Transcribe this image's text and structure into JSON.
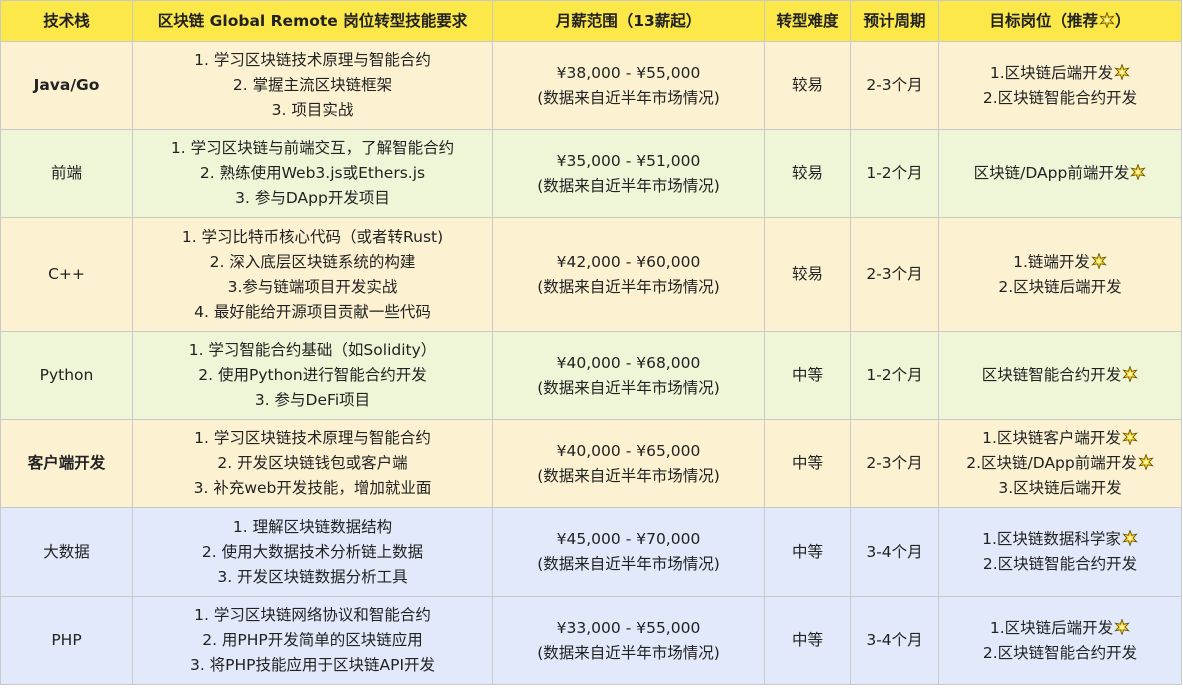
{
  "headers": [
    "技术栈",
    "区块链 Global Remote 岗位转型技能要求",
    "月薪范围（13薪起）",
    "转型难度",
    "预计周期",
    "目标岗位（推荐"
  ],
  "rows": [
    {
      "stack": "Java/Go",
      "bold": true,
      "skills": [
        "1. 学习区块链技术原理与智能合约",
        "2. 掌握主流区块链框架",
        "3. 项目实战"
      ],
      "salary": "¥38,000 - ¥55,000",
      "salary_note": "(数据来自近半年市场情况)",
      "difficulty": "较易",
      "period": "2-3个月",
      "targets": [
        {
          "text": "1.区块链后端开发",
          "star": true
        },
        {
          "text": "2.区块链智能合约开发",
          "star": false
        }
      ]
    },
    {
      "stack": "前端",
      "bold": false,
      "skills": [
        "1. 学习区块链与前端交互，了解智能合约",
        "2. 熟练使用Web3.js或Ethers.js",
        "3. 参与DApp开发项目"
      ],
      "salary": "¥35,000 - ¥51,000",
      "salary_note": "(数据来自近半年市场情况)",
      "difficulty": "较易",
      "period": "1-2个月",
      "targets": [
        {
          "text": "区块链/DApp前端开发",
          "star": true
        }
      ]
    },
    {
      "stack": "C++",
      "bold": false,
      "skills": [
        "1. 学习比特币核心代码（或者转Rust)",
        "2. 深入底层区块链系统的构建",
        "3.参与链端项目开发实战",
        "4. 最好能给开源项目贡献一些代码"
      ],
      "salary": "¥42,000 - ¥60,000",
      "salary_note": "(数据来自近半年市场情况)",
      "difficulty": "较易",
      "period": "2-3个月",
      "targets": [
        {
          "text": "1.链端开发",
          "star": true
        },
        {
          "text": "2.区块链后端开发",
          "star": false
        }
      ]
    },
    {
      "stack": "Python",
      "bold": false,
      "skills": [
        "1. 学习智能合约基础（如Solidity）",
        "2. 使用Python进行智能合约开发",
        "3. 参与DeFi项目"
      ],
      "salary": "¥40,000 - ¥68,000",
      "salary_note": "(数据来自近半年市场情况)",
      "difficulty": "中等",
      "period": "1-2个月",
      "targets": [
        {
          "text": "区块链智能合约开发",
          "star": true
        }
      ]
    },
    {
      "stack": "客户端开发",
      "bold": true,
      "skills": [
        "1. 学习区块链技术原理与智能合约",
        "2. 开发区块链钱包或客户端",
        "3. 补充web开发技能，增加就业面"
      ],
      "salary": "¥40,000 - ¥65,000",
      "salary_note": "(数据来自近半年市场情况)",
      "difficulty": "中等",
      "period": "2-3个月",
      "targets": [
        {
          "text": "1.区块链客户端开发",
          "star": true
        },
        {
          "text": "2.区块链/DApp前端开发",
          "star": true
        },
        {
          "text": "3.区块链后端开发",
          "star": false
        }
      ]
    },
    {
      "stack": "大数据",
      "bold": false,
      "skills": [
        "1. 理解区块链数据结构",
        "2. 使用大数据技术分析链上数据",
        "3. 开发区块链数据分析工具"
      ],
      "salary": "¥45,000 - ¥70,000",
      "salary_note": "(数据来自近半年市场情况)",
      "difficulty": "中等",
      "period": "3-4个月",
      "targets": [
        {
          "text": "1.区块链数据科学家",
          "star": true
        },
        {
          "text": "2.区块链智能合约开发",
          "star": false
        }
      ]
    },
    {
      "stack": "PHP",
      "bold": false,
      "skills": [
        "1. 学习区块链网络协议和智能合约",
        "2. 用PHP开发简单的区块链应用",
        "3. 将PHP技能应用于区块链API开发"
      ],
      "salary": "¥33,000 - ¥55,000",
      "salary_note": "(数据来自近半年市场情况)",
      "difficulty": "中等",
      "period": "3-4个月",
      "targets": [
        {
          "text": "1.区块链后端开发",
          "star": true
        },
        {
          "text": "2.区块链智能合约开发",
          "star": false
        }
      ]
    }
  ],
  "row_colors": [
    "yellow",
    "green",
    "yellow",
    "green",
    "yellow",
    "blue",
    "blue"
  ],
  "star_icon": "glowing-star-icon",
  "header_close": "）",
  "colors": {
    "header": "#fde84a",
    "yellow": "#fcf2d2",
    "green": "#eef6d7",
    "blue": "#e1e9fb",
    "border": "#c9c9c9"
  }
}
